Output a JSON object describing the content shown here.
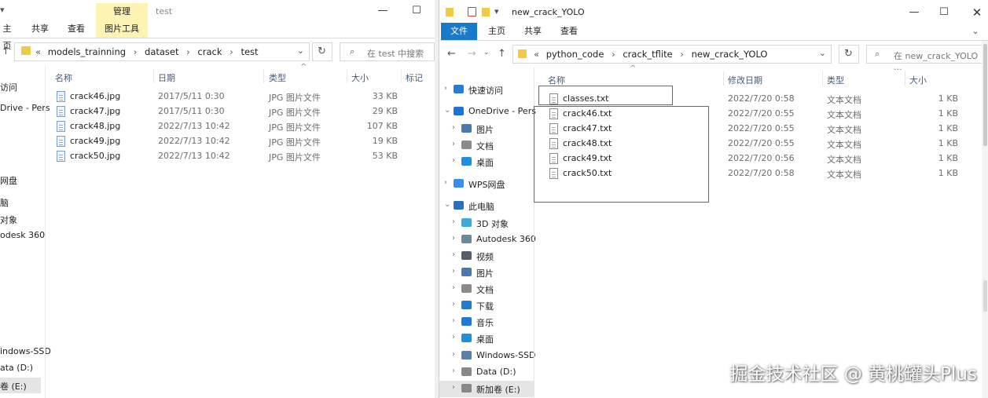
{
  "left": {
    "title": "test",
    "tabs": [
      "主页",
      "共享",
      "查看",
      "图片工具"
    ],
    "manage_tab": "管理",
    "breadcrumb": [
      "models_trainning",
      "dataset",
      "crack",
      "test"
    ],
    "search_placeholder": "在 test 中搜索",
    "columns": [
      "名称",
      "日期",
      "类型",
      "大小",
      "标记"
    ],
    "files": [
      {
        "name": "crack46.jpg",
        "date": "2017/5/11 0:30",
        "type": "JPG 图片文件",
        "size": "33 KB"
      },
      {
        "name": "crack47.jpg",
        "date": "2017/5/11 0:30",
        "type": "JPG 图片文件",
        "size": "29 KB"
      },
      {
        "name": "crack48.jpg",
        "date": "2022/7/13 10:42",
        "type": "JPG 图片文件",
        "size": "107 KB"
      },
      {
        "name": "crack49.jpg",
        "date": "2022/7/13 10:42",
        "type": "JPG 图片文件",
        "size": "19 KB"
      },
      {
        "name": "crack50.jpg",
        "date": "2022/7/13 10:42",
        "type": "JPG 图片文件",
        "size": "53 KB"
      }
    ],
    "nav_fragments": [
      "访问",
      "Drive - Pers",
      "网盘",
      "脑",
      "对象",
      "odesk 360",
      "indows-SSD",
      "ata (D:)",
      "卷 (E:)"
    ]
  },
  "right": {
    "title": "new_crack_YOLO",
    "tabs": [
      "文件",
      "主页",
      "共享",
      "查看"
    ],
    "breadcrumb": [
      "python_code",
      "crack_tflite",
      "new_crack_YOLO"
    ],
    "search_placeholder": "在 new_crack_YOLO ...",
    "columns": [
      "名称",
      "修改日期",
      "类型",
      "大小"
    ],
    "files": [
      {
        "name": "classes.txt",
        "date": "2022/7/20 0:58",
        "type": "文本文档",
        "size": "1 KB"
      },
      {
        "name": "crack46.txt",
        "date": "2022/7/20 0:55",
        "type": "文本文档",
        "size": "1 KB"
      },
      {
        "name": "crack47.txt",
        "date": "2022/7/20 0:55",
        "type": "文本文档",
        "size": "1 KB"
      },
      {
        "name": "crack48.txt",
        "date": "2022/7/20 0:55",
        "type": "文本文档",
        "size": "1 KB"
      },
      {
        "name": "crack49.txt",
        "date": "2022/7/20 0:56",
        "type": "文本文档",
        "size": "1 KB"
      },
      {
        "name": "crack50.txt",
        "date": "2022/7/20 0:58",
        "type": "文本文档",
        "size": "1 KB"
      }
    ],
    "nav": [
      {
        "label": "快速访问",
        "icon": "star-icon",
        "color": "#2b7cd3"
      },
      {
        "label": "OneDrive - Pers",
        "icon": "cloud-icon",
        "color": "#1e73d8"
      },
      {
        "label": "图片",
        "icon": "pictures-icon",
        "color": "#4a79b0"
      },
      {
        "label": "文档",
        "icon": "documents-icon",
        "color": "#8a8a8a"
      },
      {
        "label": "桌面",
        "icon": "desktop-icon",
        "color": "#1f8fe0"
      },
      {
        "label": "WPS网盘",
        "icon": "cloud-icon",
        "color": "#3a8ee6"
      },
      {
        "label": "此电脑",
        "icon": "computer-icon",
        "color": "#2a6fb8"
      },
      {
        "label": "3D 对象",
        "icon": "cube-icon",
        "color": "#3fa9d8"
      },
      {
        "label": "Autodesk 360",
        "icon": "autodesk-icon",
        "color": "#6a8a9a"
      },
      {
        "label": "视频",
        "icon": "video-icon",
        "color": "#555e6b"
      },
      {
        "label": "图片",
        "icon": "pictures-icon",
        "color": "#4a79b0"
      },
      {
        "label": "文档",
        "icon": "documents-icon",
        "color": "#8a8a8a"
      },
      {
        "label": "下载",
        "icon": "download-icon",
        "color": "#1f7ad8"
      },
      {
        "label": "音乐",
        "icon": "music-icon",
        "color": "#1f7ad8"
      },
      {
        "label": "桌面",
        "icon": "desktop-icon",
        "color": "#1f8fe0"
      },
      {
        "label": "Windows-SSD",
        "icon": "drive-icon",
        "color": "#5a7fa8"
      },
      {
        "label": "Data (D:)",
        "icon": "drive-icon",
        "color": "#888888"
      },
      {
        "label": "新加卷 (E:)",
        "icon": "drive-icon",
        "color": "#888888"
      }
    ]
  },
  "watermark": "掘金技术社区 @ 黄桃罐头Plus",
  "colors": {
    "accent": "#1979ca",
    "highlight": "#e2333f",
    "manage": "#fdf3b3"
  }
}
